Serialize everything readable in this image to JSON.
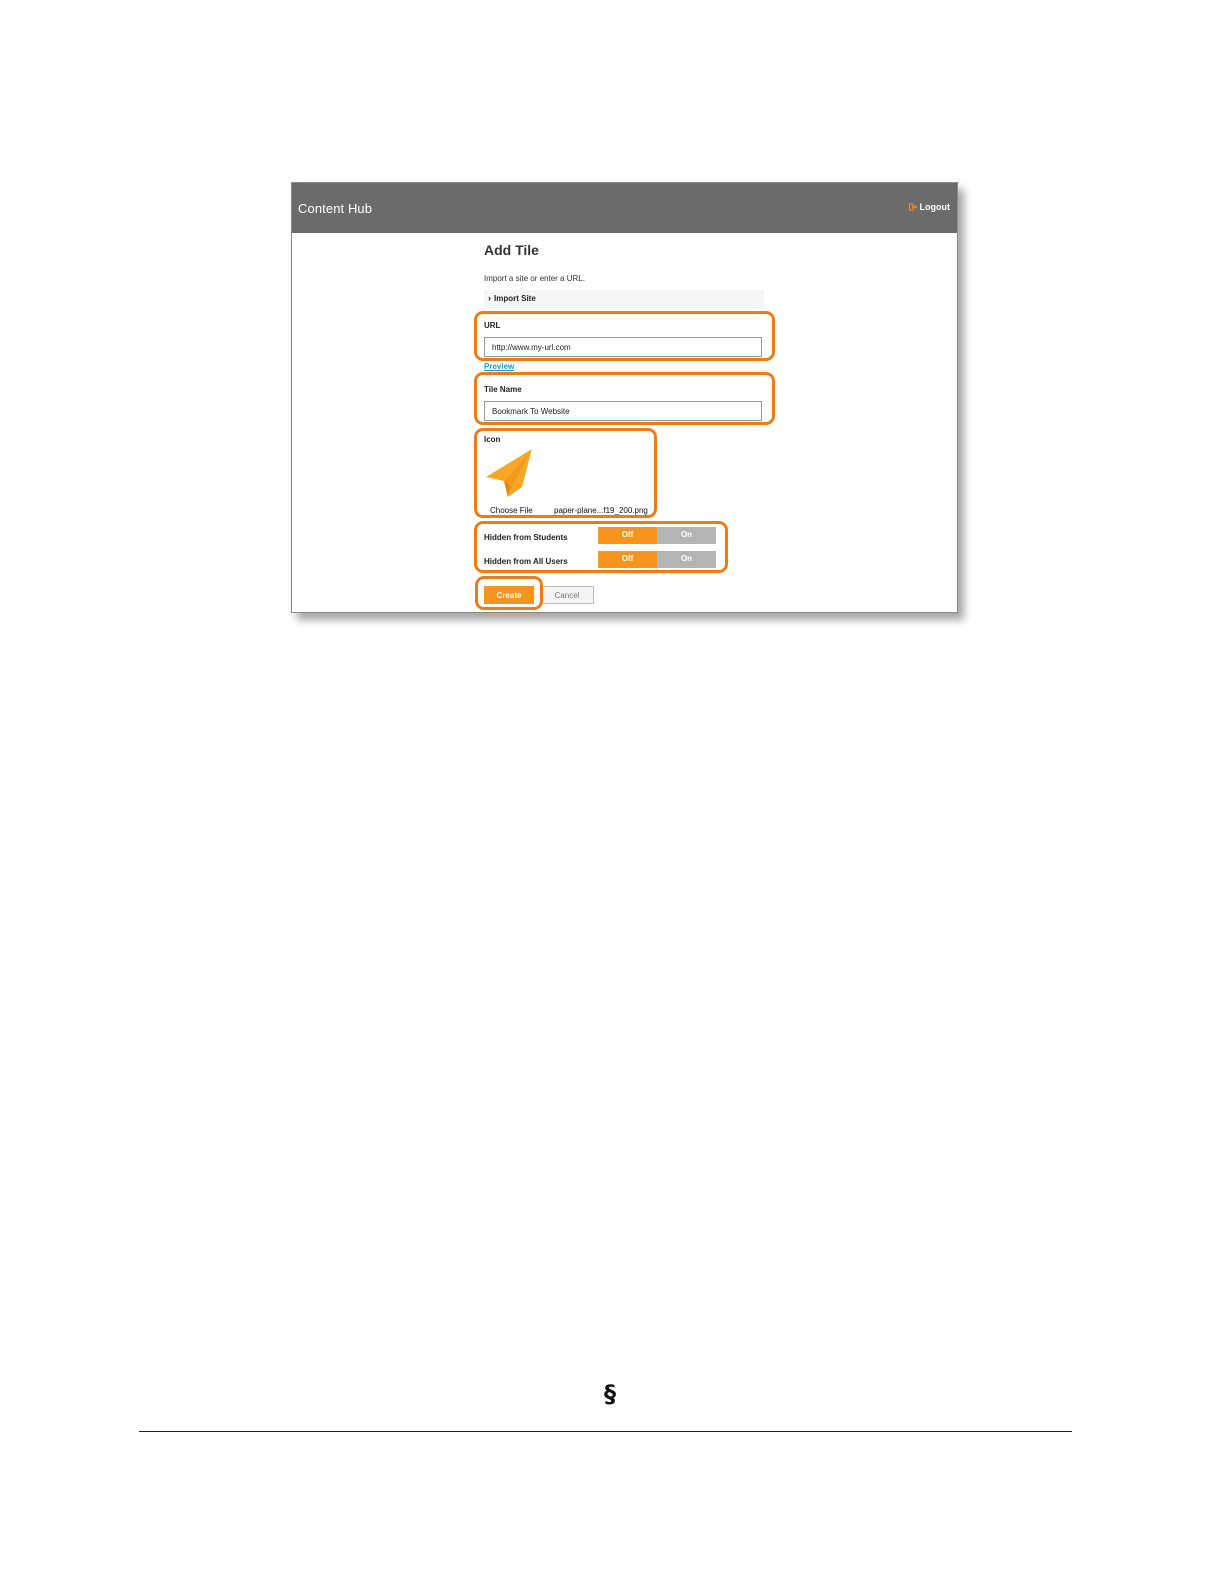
{
  "app": {
    "title": "Content Hub",
    "logout_label": "Logout"
  },
  "form": {
    "title": "Add Tile",
    "intro": "Import a site or enter a URL.",
    "import_site_label": "Import Site",
    "url_label": "URL",
    "url_value": "http://www.my-url.com",
    "preview_label": "Preview",
    "tile_name_label": "Tile Name",
    "tile_name_value": "Bookmark To Website",
    "icon_label": "Icon",
    "icon_image": "paper-plane-icon",
    "choose_file_label": "Choose File",
    "file_name": "paper-plane...f19_200.png",
    "toggles": [
      {
        "label": "Hidden from Students",
        "off": "Off",
        "on": "On",
        "selected": "Off"
      },
      {
        "label": "Hidden from All Users",
        "off": "Off",
        "on": "On",
        "selected": "Off"
      }
    ],
    "create_label": "Create",
    "cancel_label": "Cancel"
  },
  "colors": {
    "accent": "#f7941d",
    "highlight": "#ea7d1a",
    "topbar": "#6b6b6b",
    "toggle_inactive": "#b4b4b4",
    "link": "#1a9bd7"
  },
  "page": {
    "section_mark": "§"
  }
}
